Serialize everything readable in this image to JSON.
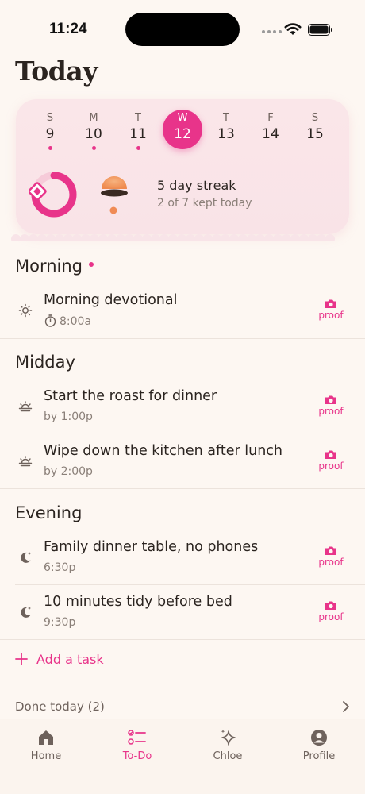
{
  "status": {
    "time": "11:24"
  },
  "page": {
    "title": "Today"
  },
  "week": [
    {
      "letter": "S",
      "num": "9",
      "dot": true
    },
    {
      "letter": "M",
      "num": "10",
      "dot": true
    },
    {
      "letter": "T",
      "num": "11",
      "dot": true
    },
    {
      "letter": "W",
      "num": "12",
      "dot": false,
      "selected": true
    },
    {
      "letter": "T",
      "num": "13",
      "dot": false
    },
    {
      "letter": "F",
      "num": "14",
      "dot": false
    },
    {
      "letter": "S",
      "num": "15",
      "dot": false
    }
  ],
  "streak": {
    "title": "5 day streak",
    "subtitle": "2 of 7 kept today",
    "progress_fraction": 0.75
  },
  "sections": {
    "morning": {
      "title": "Morning"
    },
    "midday": {
      "title": "Midday"
    },
    "evening": {
      "title": "Evening"
    }
  },
  "tasks": [
    {
      "name": "Morning devotional",
      "time": "8:00a",
      "icon": "sun-icon",
      "proof": "proof"
    },
    {
      "name": "Start the roast for dinner",
      "time": "by 1:00p",
      "icon": "sunrise-icon",
      "proof": "proof"
    },
    {
      "name": "Wipe down the kitchen after lunch",
      "time": "by 2:00p",
      "icon": "sunrise-icon",
      "proof": "proof"
    },
    {
      "name": "Family dinner table, no phones",
      "time": "6:30p",
      "icon": "moon-icon",
      "proof": "proof"
    },
    {
      "name": "10 minutes tidy before bed",
      "time": "9:30p",
      "icon": "moon-icon",
      "proof": "proof"
    }
  ],
  "add_task": {
    "label": "Add a task",
    "icon": "plus-icon"
  },
  "done_today": {
    "label": "Done today (2)"
  },
  "tabs": [
    {
      "label": "Home",
      "icon": "home-icon"
    },
    {
      "label": "To-Do",
      "icon": "checklist-icon",
      "active": true
    },
    {
      "label": "Chloe",
      "icon": "sparkle-icon"
    },
    {
      "label": "Profile",
      "icon": "profile-icon"
    }
  ],
  "colors": {
    "accent": "#e8348a",
    "background": "#fdf7f2",
    "card": "#fae6e9",
    "mascot": "#f4a06a"
  }
}
